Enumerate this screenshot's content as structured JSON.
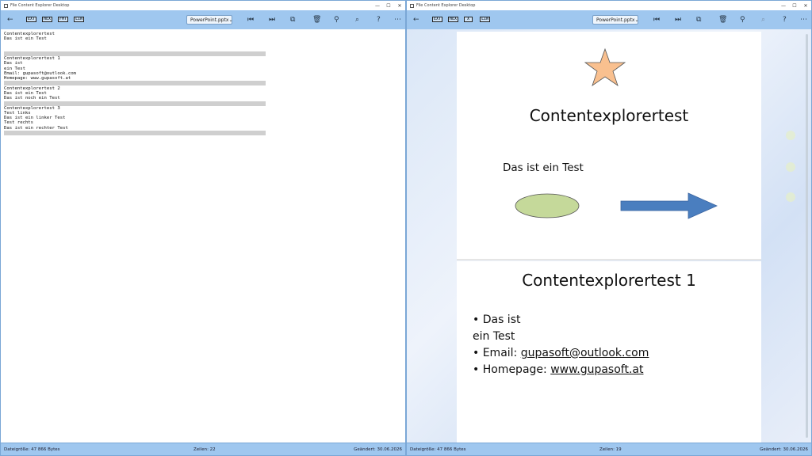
{
  "app": {
    "title": "File Content Explorer Desktop"
  },
  "windows": [
    {
      "file_dropdown": "PowerPoint.pptx",
      "buttons": {
        "ext": "EXT",
        "hex": "HEX",
        "fmt": "FMT",
        "lin": "LIN"
      },
      "status": {
        "size": "Dateigröße: 47 866 Bytes",
        "lines": "Zeilen: 22",
        "modified": "Geändert: 30.06.2026"
      },
      "text_lines": [
        "Contentexplorertest",
        "Das ist ein Test",
        "",
        "",
        "",
        "Contentexplorertest 1",
        "Das ist",
        "ein Test",
        "Email: gupasoft@outlook.com",
        "Homepage: www.gupasoft.at",
        "",
        "Contentexplorertest 2",
        "Das ist ein Test",
        "Das ist noch ein Test",
        "",
        "Contentexplorertest 3",
        "Test links",
        "Das ist ein linker Test",
        "Test rechts",
        "Das ist ein rechter Test",
        ""
      ]
    },
    {
      "file_dropdown": "PowerPoint.pptx",
      "buttons": {
        "ext": "EXT",
        "hex": "HEX",
        "x": "X",
        "lin": "LIN"
      },
      "status": {
        "size": "Dateigröße: 47 866 Bytes",
        "lines": "Zeilen: 19",
        "modified": "Geändert: 30.06.2026"
      }
    }
  ],
  "slides": [
    {
      "title": "Contentexplorertest",
      "text": "Das ist ein Test"
    },
    {
      "title": "Contentexplorertest 1",
      "bullets": [
        "• Das ist",
        "ein Test",
        "• Email: ",
        "• Homepage: "
      ],
      "email": "gupasoft@outlook.com",
      "homepage": "www.gupasoft.at"
    }
  ],
  "colors": {
    "toolbar": "#9fc7ef",
    "star": "#f9c08f",
    "ellipse": "#c5d99a",
    "arrow": "#4a7ebf"
  },
  "icons": [
    "back-arrow-icon",
    "first-icon",
    "last-icon",
    "copy-icon",
    "delete-icon",
    "pin-icon",
    "search-icon",
    "help-icon",
    "more-icon"
  ]
}
